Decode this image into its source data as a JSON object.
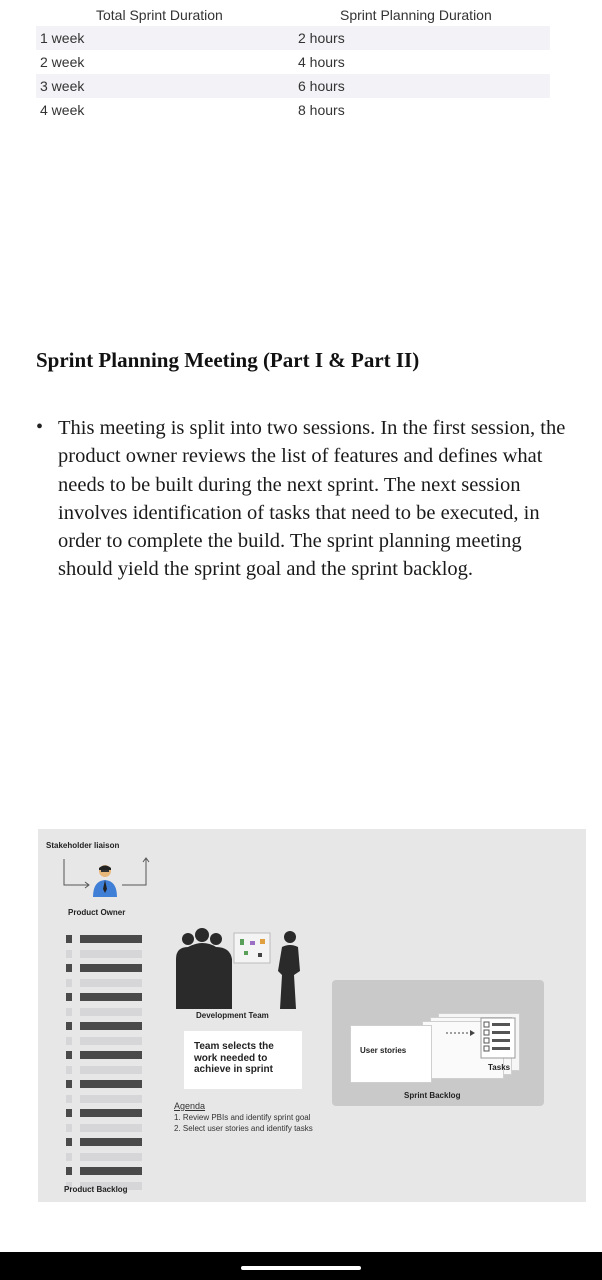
{
  "table": {
    "headers": [
      "Total Sprint Duration",
      "Sprint Planning Duration"
    ],
    "rows": [
      [
        "1 week",
        "2 hours"
      ],
      [
        "2 week",
        "4 hours"
      ],
      [
        "3 week",
        "6 hours"
      ],
      [
        "4 week",
        "8 hours"
      ]
    ]
  },
  "heading": "Sprint Planning Meeting (Part I & Part II)",
  "bullet": "This meeting is split into two sessions. In the first session, the product owner reviews the list of features and defines what needs to be built during the next sprint. The next session involves identification of tasks that need to be executed, in order to complete the build. The sprint planning meeting should yield the sprint goal and the sprint backlog.",
  "diagram": {
    "stakeholder_label": "Stakeholder liaison",
    "product_owner_label": "Product Owner",
    "product_backlog_label": "Product Backlog",
    "dev_team_label": "Development Team",
    "team_box_text": "Team selects the work needed to achieve in sprint",
    "agenda_heading": "Agenda",
    "agenda_items": [
      "1. Review PBIs and identify sprint goal",
      "2. Select user stories and identify tasks"
    ],
    "user_stories_label": "User stories",
    "tasks_label": "Tasks",
    "sprint_backlog_label": "Sprint Backlog"
  },
  "colors": {
    "diagram_bg": "#e7e7e7",
    "panel_bg": "#c9c9c9",
    "dark_gray": "#4a4a4a",
    "person_shirt": "#3f7fd6"
  }
}
